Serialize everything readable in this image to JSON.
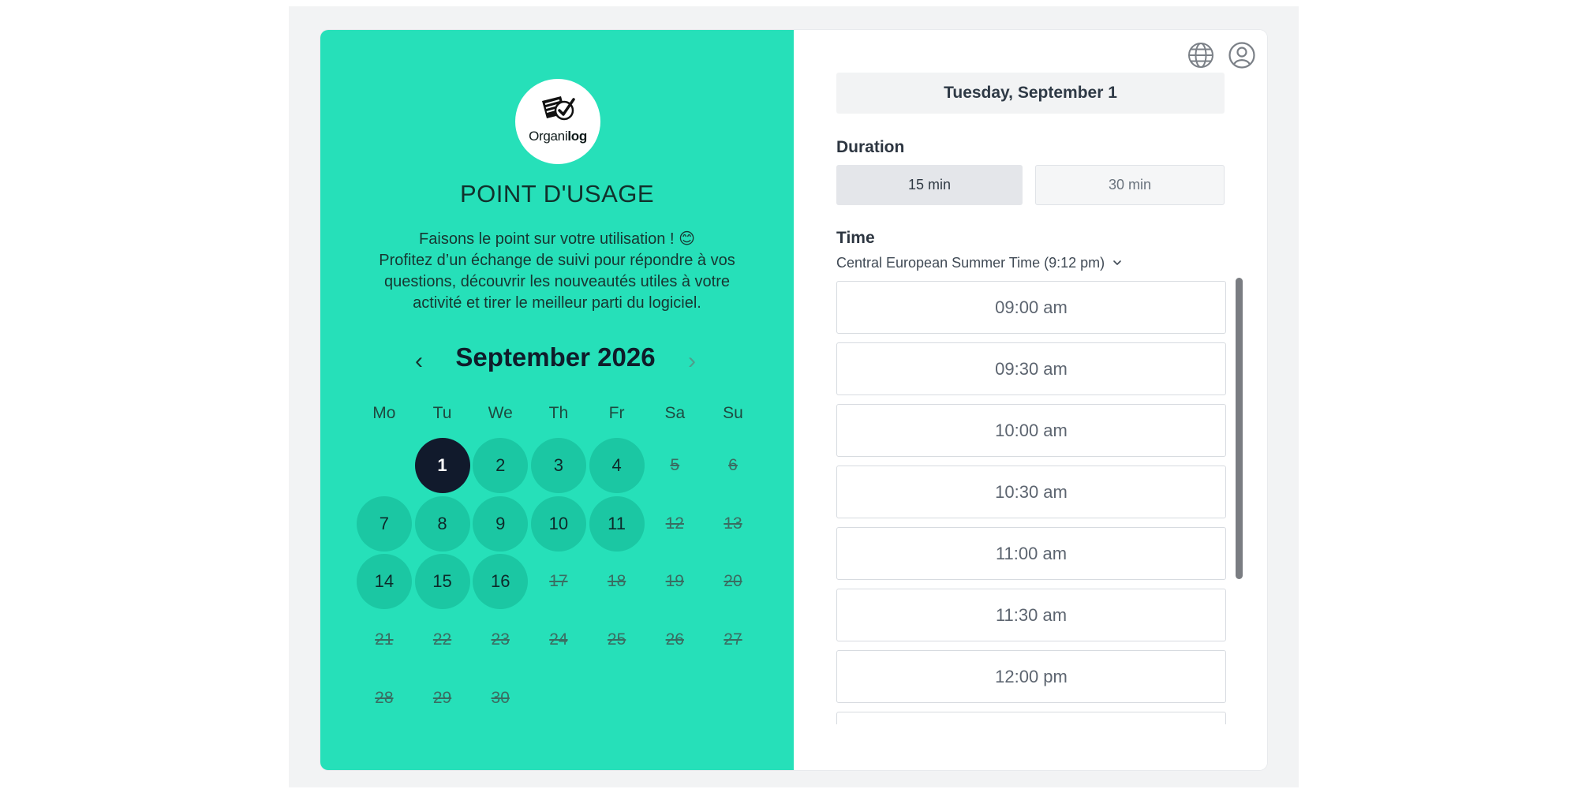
{
  "logo": {
    "text_regular": "Organi",
    "text_bold": "log"
  },
  "event": {
    "title": "POINT D'USAGE",
    "description": [
      "Faisons le point sur votre utilisation ! 😊",
      "Profitez d’un échange de suivi pour répondre à vos",
      "questions, découvrir les nouveautés utiles à votre",
      "activité et tirer le meilleur parti du logiciel."
    ]
  },
  "calendar": {
    "month_label": "September 2026",
    "prev_symbol": "‹",
    "next_symbol": "›",
    "weekdays": [
      "Mo",
      "Tu",
      "We",
      "Th",
      "Fr",
      "Sa",
      "Su"
    ],
    "first_day_offset": 1,
    "selected_day": 1,
    "available_days": [
      1,
      2,
      3,
      4,
      7,
      8,
      9,
      10,
      11,
      14,
      15,
      16
    ],
    "days": [
      "1",
      "2",
      "3",
      "4",
      "5",
      "6",
      "7",
      "8",
      "9",
      "10",
      "11",
      "12",
      "13",
      "14",
      "15",
      "16",
      "17",
      "18",
      "19",
      "20",
      "21",
      "22",
      "23",
      "24",
      "25",
      "26",
      "27",
      "28",
      "29",
      "30"
    ]
  },
  "selected_date_label": "Tuesday, September 1",
  "duration": {
    "label": "Duration",
    "options": [
      "15 min",
      "30 min"
    ],
    "selected": "15 min"
  },
  "time": {
    "label": "Time",
    "timezone": "Central European Summer Time (9:12 pm)",
    "slots": [
      "09:00 am",
      "09:30 am",
      "10:00 am",
      "10:30 am",
      "11:00 am",
      "11:30 am",
      "12:00 pm",
      ""
    ]
  },
  "colors": {
    "panel_accent": "#26e0b9",
    "available_day": "#1bc7a3",
    "selected_day": "#111a2c"
  },
  "icons": {
    "language": "globe-icon",
    "account": "user-circle-icon"
  }
}
